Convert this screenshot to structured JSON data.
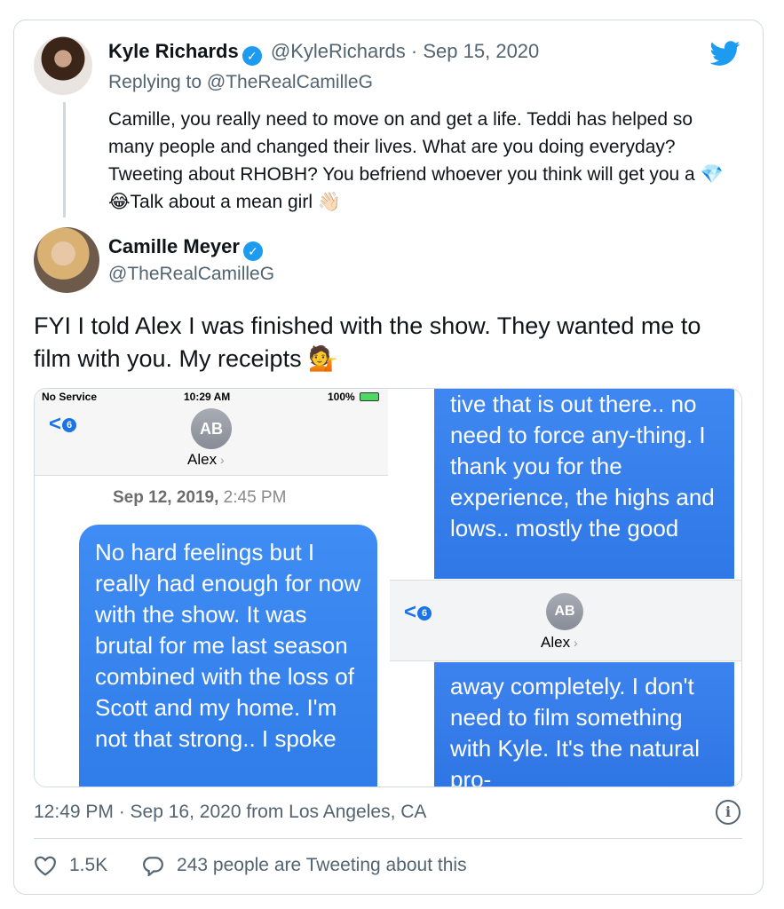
{
  "parent": {
    "name": "Kyle Richards",
    "handle": "@KyleRichards",
    "separator": "·",
    "date": "Sep 15, 2020",
    "replying": "Replying to @TheRealCamilleG",
    "text": "Camille, you really need to move on and get a life. Teddi has helped so many people and changed their lives. What are you doing everyday? Tweeting about RHOBH? You befriend whoever you think will get you a 💎😂Talk about a mean girl 👋🏻"
  },
  "tweet": {
    "name": "Camille Meyer",
    "handle": "@TheRealCamilleG",
    "text": "FYI I told Alex I was finished with the show. They wanted me to film with you. My receipts 💁",
    "meta": "12:49 PM · Sep 16, 2020 from Los Angeles, CA",
    "likes": "1.5K",
    "replies_text": "243 people are Tweeting about this"
  },
  "left_screenshot": {
    "carrier": "No Service",
    "time": "10:29 AM",
    "battery": "100%",
    "back_count": "6",
    "initials": "AB",
    "contact": "Alex",
    "date_bold": "Sep 12, 2019,",
    "date_time": " 2:45 PM",
    "message": "No hard feelings but I really had enough for now with the show. It was brutal for me last season combined with the loss of Scott and my home. I'm not that strong.. I spoke"
  },
  "right_screenshot": {
    "top_message": "tive that is out there.. no need to force any-thing. I thank you for the experience, the highs and lows.. mostly the good",
    "back_count": "6",
    "initials": "AB",
    "contact": "Alex",
    "bottom_message": "away completely.  I don't  need to film something with Kyle. It's the natural pro-"
  },
  "icons": {
    "verified": "verified-badge-icon",
    "bird": "twitter-bird-icon",
    "heart": "heart-icon",
    "reply": "reply-bubble-icon",
    "info": "info-icon"
  },
  "colors": {
    "accent": "#1d9bf0",
    "bubble": "#3586f0"
  }
}
